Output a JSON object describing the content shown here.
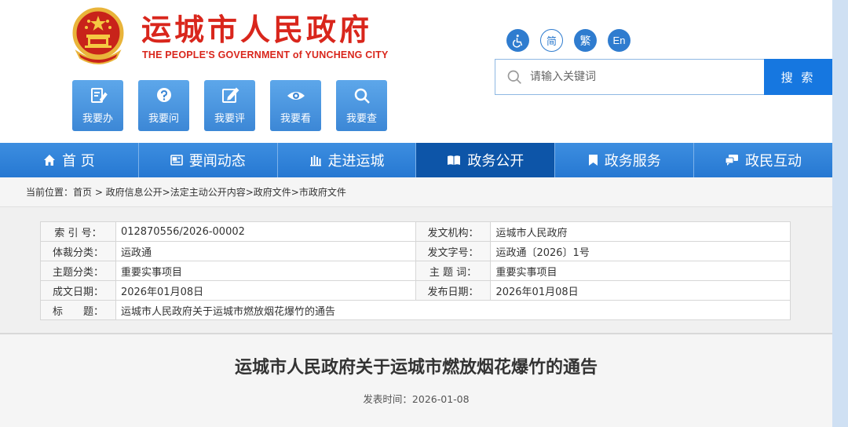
{
  "header": {
    "title": "运城市人民政府",
    "title_en": "THE PEOPLE'S GOVERNMENT of YUNCHENG CITY",
    "emblem": "national-emblem"
  },
  "quick_links": [
    {
      "label": "我要办",
      "icon": "edit-doc-icon"
    },
    {
      "label": "我要问",
      "icon": "question-icon"
    },
    {
      "label": "我要评",
      "icon": "pen-icon"
    },
    {
      "label": "我要看",
      "icon": "eye-icon"
    },
    {
      "label": "我要查",
      "icon": "search-icon"
    }
  ],
  "tools": {
    "accessibility": "accessibility-icon",
    "simplified": "简",
    "traditional": "繁",
    "english": "En"
  },
  "search": {
    "placeholder": "请输入关键词",
    "button": "搜 索"
  },
  "nav": [
    {
      "label": "首 页",
      "icon": "home-icon",
      "active": false
    },
    {
      "label": "要闻动态",
      "icon": "news-icon",
      "active": false
    },
    {
      "label": "走进运城",
      "icon": "building-icon",
      "active": false
    },
    {
      "label": "政务公开",
      "icon": "book-icon",
      "active": true
    },
    {
      "label": "政务服务",
      "icon": "bookmark-icon",
      "active": false
    },
    {
      "label": "政民互动",
      "icon": "chat-icon",
      "active": false
    }
  ],
  "breadcrumb": "当前位置：首页 > 政府信息公开>法定主动公开内容>政府文件>市政府文件",
  "meta": {
    "index_no_label": "索 引 号：",
    "index_no": "012870556/2026-00002",
    "issuer_label": "发文机构：",
    "issuer": "运城市人民政府",
    "genre_label": "体裁分类：",
    "genre": "运政通",
    "doc_no_label": "发文字号：",
    "doc_no": "运政通〔2026〕1号",
    "topic_label": "主题分类：",
    "topic": "重要实事项目",
    "keyword_label": "主 题 词：",
    "keyword": "重要实事项目",
    "written_label": "成文日期：",
    "written": "2026年01月08日",
    "published_label": "发布日期：",
    "published": "2026年01月08日",
    "subject_label": "标　　题：",
    "subject": "运城市人民政府关于运城市燃放烟花爆竹的通告"
  },
  "article": {
    "title": "运城市人民政府关于运城市燃放烟花爆竹的通告",
    "pub_date": "发表时间：2026-01-08"
  },
  "colors": {
    "brand_red": "#d9261c",
    "nav_blue": "#2678d2",
    "active_nav": "#0d55a8",
    "search_button": "#1677e0"
  }
}
